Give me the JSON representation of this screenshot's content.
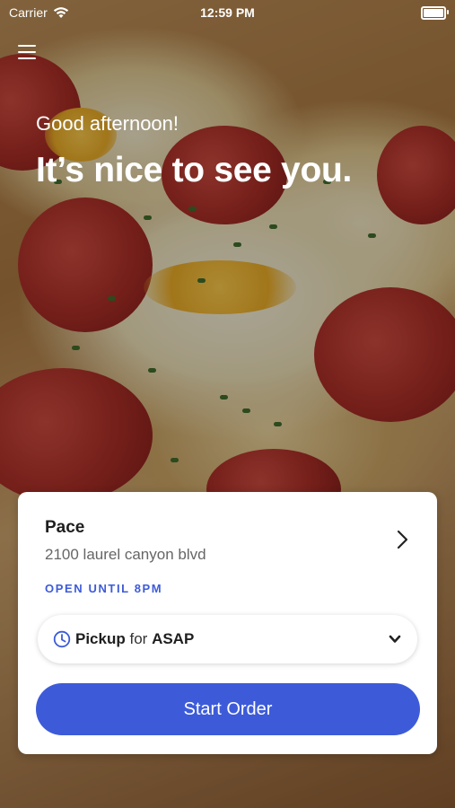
{
  "status_bar": {
    "carrier": "Carrier",
    "time": "12:59 PM"
  },
  "header": {
    "greeting": "Good afternoon!",
    "headline": "It’s nice to see you."
  },
  "store": {
    "name": "Pace",
    "address": "2100 laurel canyon blvd",
    "hours": "OPEN UNTIL 8PM"
  },
  "order_mode": {
    "mode": "Pickup",
    "connector": "for",
    "time": "ASAP"
  },
  "actions": {
    "start_order": "Start Order"
  },
  "icons": {
    "menu": "hamburger-icon",
    "store_detail": "chevron-right-icon",
    "pickup_time": "clock-icon",
    "dropdown": "chevron-down-icon",
    "wifi": "wifi-icon",
    "battery": "battery-icon"
  },
  "colors": {
    "accent": "#3d5bd9",
    "card": "#ffffff",
    "text": "#1e1e1e"
  }
}
